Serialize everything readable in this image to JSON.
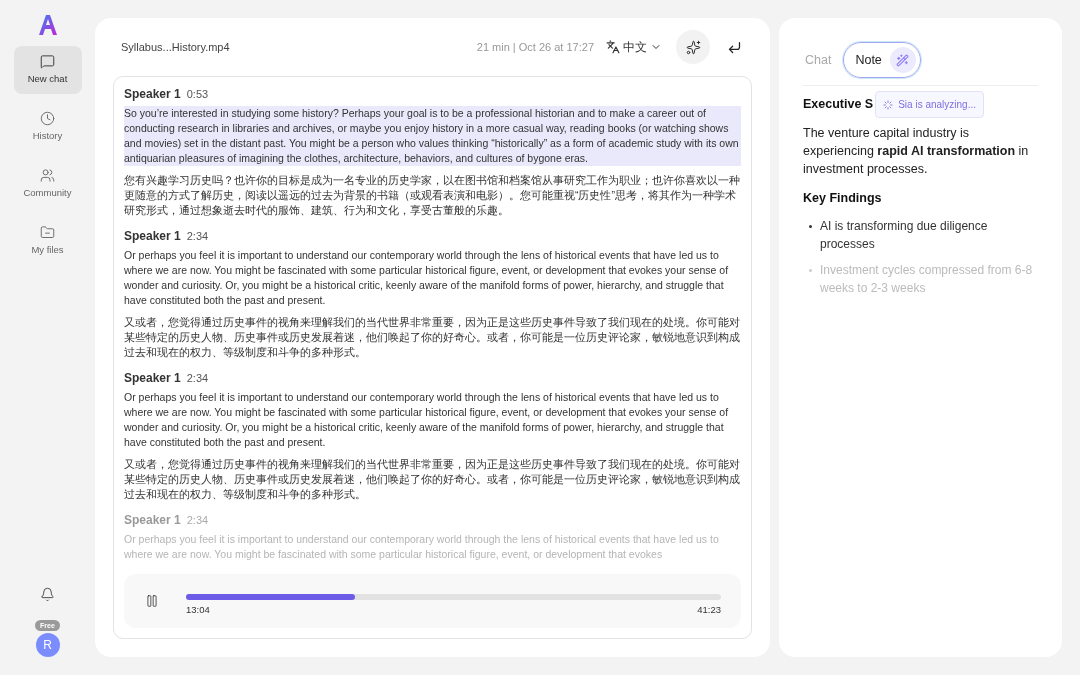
{
  "sidebar": {
    "items": [
      {
        "label": "New chat",
        "selected": true
      },
      {
        "label": "History",
        "selected": false
      },
      {
        "label": "Community",
        "selected": false
      },
      {
        "label": "My files",
        "selected": false
      }
    ],
    "plan_badge": "Free",
    "avatar": "R"
  },
  "file": {
    "name": "Syllabus...History.mp4",
    "meta": "21 min | Oct 26 at 17:27",
    "language": "中文"
  },
  "transcript": [
    {
      "speaker": "Speaker 1",
      "time": "0:53",
      "highlighted": true,
      "faded": false,
      "text": "So you’re interested in studying some history? Perhaps your goal is to be a professional historian and to make a career out of conducting research in libraries and archives, or maybe you enjoy history in a more casual way, reading books (or watching shows and movies) set in the distant past. You might be a person who values thinking “historically” as a form of academic study with its own antiquarian pleasures of imagining the clothes, architecture, behaviors, and cultures of bygone eras.",
      "translation": "您有兴趣学习历史吗？也许你的目标是成为一名专业的历史学家，以在图书馆和档案馆从事研究工作为职业；也许你喜欢以一种更随意的方式了解历史，阅读以遥远的过去为背景的书籍（或观看表演和电影）。您可能重视“历史性”思考，将其作为一种学术研究形式，通过想象逝去时代的服饰、建筑、行为和文化，享受古董般的乐趣。"
    },
    {
      "speaker": "Speaker 1",
      "time": "2:34",
      "highlighted": false,
      "faded": false,
      "text": "Or perhaps you feel it is important to understand our contemporary world through the lens of historical events that have led us to where we are now. You might be fascinated with some particular historical figure, event, or development that evokes your sense of wonder and curiosity. Or, you might be a historical critic, keenly aware of the manifold forms of power, hierarchy, and struggle that have constituted both the past and present.",
      "translation": "又或者，您觉得通过历史事件的视角来理解我们的当代世界非常重要，因为正是这些历史事件导致了我们现在的处境。你可能对某些特定的历史人物、历史事件或历史发展着迷，他们唤起了你的好奇心。或者，你可能是一位历史评论家，敏锐地意识到构成过去和现在的权力、等级制度和斗争的多种形式。"
    },
    {
      "speaker": "Speaker 1",
      "time": "2:34",
      "highlighted": false,
      "faded": false,
      "text": "Or perhaps you feel it is important to understand our contemporary world through the lens of historical events that have led us to where we are now. You might be fascinated with some particular historical figure, event, or development that evokes your sense of wonder and curiosity. Or, you might be a historical critic, keenly aware of the manifold forms of power, hierarchy, and struggle that have constituted both the past and present.",
      "translation": "又或者，您觉得通过历史事件的视角来理解我们的当代世界非常重要，因为正是这些历史事件导致了我们现在的处境。你可能对某些特定的历史人物、历史事件或历史发展着迷，他们唤起了你的好奇心。或者，你可能是一位历史评论家，敏锐地意识到构成过去和现在的权力、等级制度和斗争的多种形式。"
    },
    {
      "speaker": "Speaker 1",
      "time": "2:34",
      "highlighted": false,
      "faded": true,
      "text": "Or perhaps you feel it is important to understand our contemporary world through the lens of historical events that have led us to where we are now. You might be fascinated with some particular historical figure, event, or development that evokes"
    }
  ],
  "player": {
    "playing": true,
    "level": 0.316,
    "elapsed": "13:04",
    "total": "41:23"
  },
  "panel": {
    "tabs": [
      {
        "label": "Chat",
        "selected": false
      },
      {
        "label": "Note",
        "selected": true
      }
    ],
    "status": "Sia is analyzing...",
    "heading": "Executive S",
    "summary": "The venture capital industry is experiencing **rapid AI transformation** in investment processes.",
    "subheading": "Key Findings",
    "findings": [
      {
        "text": "AI is transforming due diligence processes",
        "faded": false
      },
      {
        "text": "Investment cycles compressed from 6-8 weeks to 2-3 weeks",
        "faded": true
      }
    ]
  }
}
